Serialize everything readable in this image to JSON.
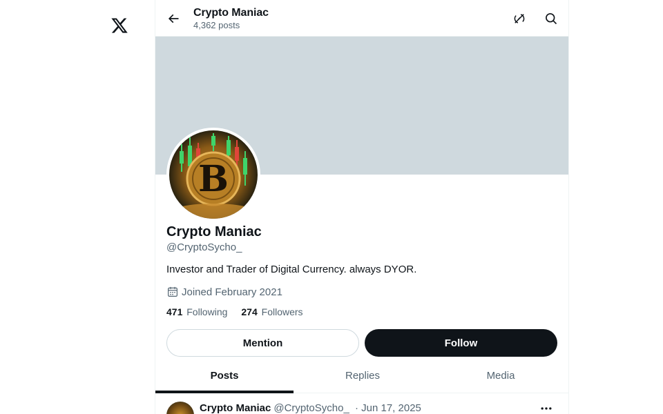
{
  "header": {
    "title": "Crypto Maniac",
    "post_count": "4,362 posts"
  },
  "profile": {
    "name": "Crypto Maniac",
    "handle": "@CryptoSycho_",
    "bio": "Investor and Trader of Digital Currency. always DYOR.",
    "joined": "Joined February 2021",
    "following_count": "471",
    "following_label": "Following",
    "followers_count": "274",
    "followers_label": "Followers"
  },
  "actions": {
    "mention_label": "Mention",
    "follow_label": "Follow"
  },
  "tabs": [
    {
      "label": "Posts",
      "active": true
    },
    {
      "label": "Replies",
      "active": false
    },
    {
      "label": "Media",
      "active": false
    }
  ],
  "post": {
    "author_name": "Crypto Maniac",
    "author_handle": "@CryptoSycho_",
    "date": "· Jun 17, 2025"
  },
  "colors": {
    "banner": "#cfd9de",
    "text_primary": "#0f1419",
    "text_secondary": "#536471",
    "follow_bg": "#0f1419"
  },
  "icons": {
    "logo": "x-logo-icon",
    "back": "back-arrow-icon",
    "grok": "grok-icon",
    "search": "search-icon",
    "calendar": "calendar-icon",
    "more": "more-icon"
  }
}
